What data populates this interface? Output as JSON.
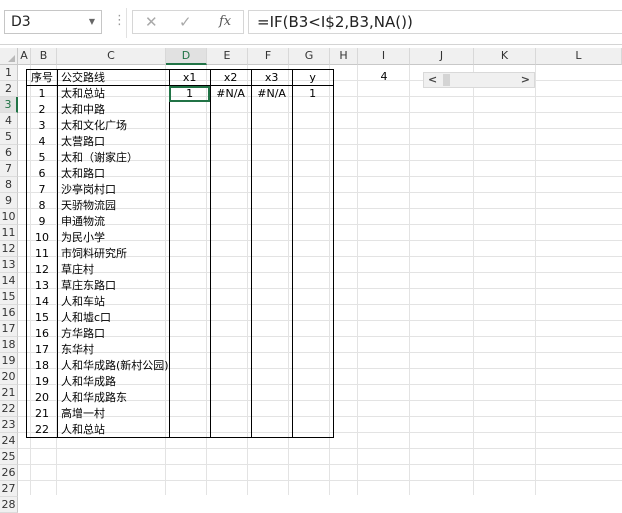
{
  "name_box": "D3",
  "formula": "=IF(B3<I$2,B3,NA())",
  "formula_buttons": {
    "cancel": "✕",
    "enter": "✓",
    "fx": "fx"
  },
  "columns": [
    "A",
    "B",
    "C",
    "D",
    "E",
    "F",
    "G",
    "H",
    "I",
    "J",
    "K",
    "L"
  ],
  "rows": [
    "1",
    "2",
    "3",
    "4",
    "5",
    "6",
    "7",
    "8",
    "9",
    "10",
    "11",
    "12",
    "13",
    "14",
    "15",
    "16",
    "17",
    "18",
    "19",
    "20",
    "21",
    "22",
    "23",
    "24",
    "25",
    "26",
    "27",
    "28"
  ],
  "table": {
    "headers": [
      "序号",
      "公交路线",
      "x1",
      "x2",
      "x3",
      "y"
    ],
    "rows": [
      [
        "1",
        "太和总站",
        "1",
        "#N/A",
        "#N/A",
        "1"
      ],
      [
        "2",
        "太和中路",
        "",
        "",
        "",
        ""
      ],
      [
        "3",
        "太和文化广场",
        "",
        "",
        "",
        ""
      ],
      [
        "4",
        "太营路口",
        "",
        "",
        "",
        ""
      ],
      [
        "5",
        "太和（谢家庄）",
        "",
        "",
        "",
        ""
      ],
      [
        "6",
        "太和路口",
        "",
        "",
        "",
        ""
      ],
      [
        "7",
        "沙亭岗村口",
        "",
        "",
        "",
        ""
      ],
      [
        "8",
        "天骄物流园",
        "",
        "",
        "",
        ""
      ],
      [
        "9",
        "申通物流",
        "",
        "",
        "",
        ""
      ],
      [
        "10",
        "为民小学",
        "",
        "",
        "",
        ""
      ],
      [
        "11",
        "市饲料研究所",
        "",
        "",
        "",
        ""
      ],
      [
        "12",
        "草庄村",
        "",
        "",
        "",
        ""
      ],
      [
        "13",
        "草庄东路口",
        "",
        "",
        "",
        ""
      ],
      [
        "14",
        "人和车站",
        "",
        "",
        "",
        ""
      ],
      [
        "15",
        "人和墟c口",
        "",
        "",
        "",
        ""
      ],
      [
        "16",
        "方华路口",
        "",
        "",
        "",
        ""
      ],
      [
        "17",
        "东华村",
        "",
        "",
        "",
        ""
      ],
      [
        "18",
        "人和华成路(新村公园)",
        "",
        "",
        "",
        ""
      ],
      [
        "19",
        "人和华成路",
        "",
        "",
        "",
        ""
      ],
      [
        "20",
        "人和华成路东",
        "",
        "",
        "",
        ""
      ],
      [
        "21",
        "高增一村",
        "",
        "",
        "",
        ""
      ],
      [
        "22",
        "人和总站",
        "",
        "",
        "",
        ""
      ]
    ]
  },
  "cell_I2": "4",
  "scrollbar": {
    "left": "<",
    "right": ">",
    "value": 4
  }
}
